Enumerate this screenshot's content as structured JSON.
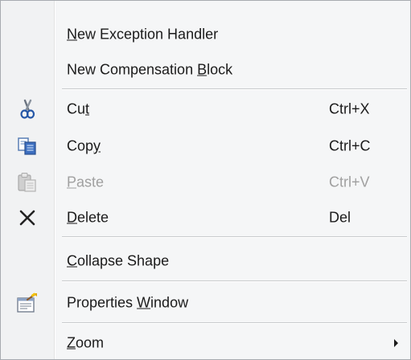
{
  "menu": {
    "items": {
      "new_exception_handler": {
        "mnemonic": "N",
        "rest": "ew Exception Handler"
      },
      "new_compensation_block": {
        "before": "New Compensation ",
        "mnemonic": "B",
        "after": "lock"
      },
      "cut": {
        "before": "Cu",
        "mnemonic": "t",
        "shortcut": "Ctrl+X",
        "icon": "scissors-icon"
      },
      "copy": {
        "before": "Cop",
        "mnemonic": "y",
        "shortcut": "Ctrl+C",
        "icon": "copy-icon"
      },
      "paste": {
        "mnemonic": "P",
        "rest": "aste",
        "shortcut": "Ctrl+V",
        "icon": "paste-icon",
        "disabled": true
      },
      "delete": {
        "mnemonic": "D",
        "rest": "elete",
        "shortcut": "Del",
        "icon": "delete-icon"
      },
      "collapse_shape": {
        "mnemonic": "C",
        "rest": "ollapse Shape"
      },
      "properties_window": {
        "before": "Properties ",
        "mnemonic": "W",
        "after": "indow",
        "icon": "properties-icon"
      },
      "zoom": {
        "mnemonic": "Z",
        "rest": "oom",
        "submenu": true
      }
    }
  }
}
